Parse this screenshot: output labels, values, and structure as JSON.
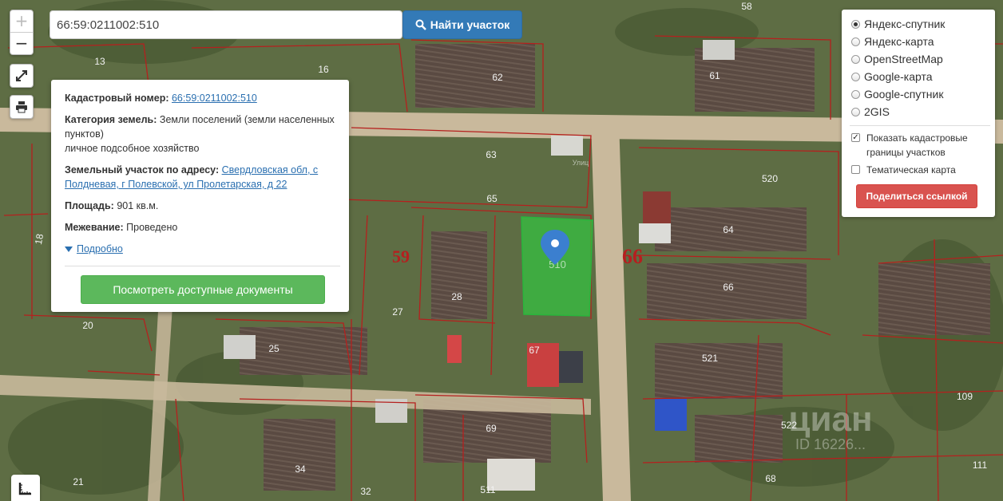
{
  "search": {
    "value": "66:59:0211002:510",
    "button_label": "Найти участок",
    "button_icon": "search-icon"
  },
  "map_controls": {
    "zoom_in": "+",
    "zoom_out": "−",
    "fullscreen_icon": "expand-icon",
    "print_icon": "printer-icon",
    "ruler_icon": "ruler-icon"
  },
  "popup": {
    "cadastral_label": "Кадастровый номер:",
    "cadastral_value": "66:59:0211002:510",
    "category_label": "Категория земель:",
    "category_value": "Земли поселений (земли населенных пунктов)",
    "usage": "личное подсобное хозяйство",
    "address_label": "Земельный участок по адресу:",
    "address_value": "Свердловская обл, с Полдневая, г Полевской, ул Пролетарская, д 22",
    "area_label": "Площадь:",
    "area_value": "901 кв.м.",
    "survey_label": "Межевание:",
    "survey_value": "Проведено",
    "more_link": "Подробно",
    "docs_button": "Посмотреть доступные документы"
  },
  "layers": {
    "options": [
      "Яндекс-спутник",
      "Яндекс-карта",
      "OpenStreetMap",
      "Google-карта",
      "Google-спутник",
      "2GIS"
    ],
    "selected_index": 0,
    "cadastral_borders_label": "Показать кадастровые границы участков",
    "cadastral_borders_checked": true,
    "thematic_label": "Тематическая карта",
    "thematic_checked": false,
    "share_button": "Поделиться ссылкой"
  },
  "map_labels": {
    "plots": [
      "58",
      "13",
      "16",
      "62",
      "61",
      "63",
      "65",
      "520",
      "64",
      "59",
      "66",
      "28",
      "27",
      "20",
      "25",
      "67",
      "66",
      "521",
      "69",
      "522",
      "109",
      "34",
      "21",
      "32",
      "511",
      "68",
      "111",
      "18"
    ],
    "selected_plot": "510",
    "road_text": "Улиц",
    "watermark_brand": "циан",
    "watermark_id": "ID 16226..."
  },
  "colors": {
    "primary": "#337ab7",
    "success": "#5cb85c",
    "danger": "#d9534f",
    "plot_border": "#b5201e",
    "selected_plot": "#2ecc40",
    "marker": "#3b7fcf"
  }
}
